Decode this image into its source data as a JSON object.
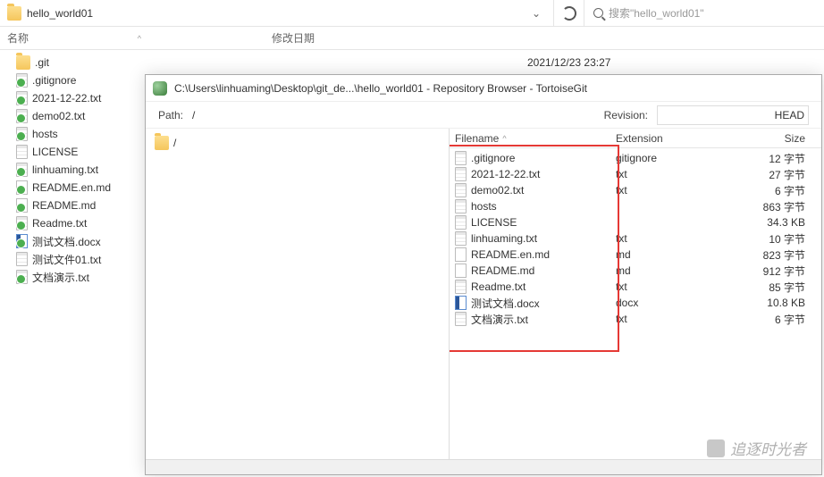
{
  "explorer": {
    "folder_title": "hello_world01",
    "search_placeholder": "搜索\"hello_world01\"",
    "columns": {
      "name": "名称",
      "date": "修改日期"
    },
    "first_date": "2021/12/23 23:27",
    "files": [
      {
        "name": ".git",
        "type": "folder",
        "overlay": false
      },
      {
        "name": ".gitignore",
        "type": "txt",
        "overlay": true
      },
      {
        "name": "2021-12-22.txt",
        "type": "txt",
        "overlay": true
      },
      {
        "name": "demo02.txt",
        "type": "txt",
        "overlay": true
      },
      {
        "name": "hosts",
        "type": "txt",
        "overlay": true
      },
      {
        "name": "LICENSE",
        "type": "txt",
        "overlay": false
      },
      {
        "name": "linhuaming.txt",
        "type": "txt",
        "overlay": true
      },
      {
        "name": "README.en.md",
        "type": "md",
        "overlay": true
      },
      {
        "name": "README.md",
        "type": "md",
        "overlay": true
      },
      {
        "name": "Readme.txt",
        "type": "txt",
        "overlay": true
      },
      {
        "name": "测试文档.docx",
        "type": "docx",
        "overlay": true
      },
      {
        "name": "测试文件01.txt",
        "type": "txt",
        "overlay": false
      },
      {
        "name": "文档演示.txt",
        "type": "txt",
        "overlay": true
      }
    ]
  },
  "git_window": {
    "title": "C:\\Users\\linhuaming\\Desktop\\git_de...\\hello_world01 - Repository Browser - TortoiseGit",
    "path_label": "Path:",
    "path_value": "/",
    "revision_label": "Revision:",
    "revision_value": "HEAD",
    "tree_root": "/",
    "columns": {
      "filename": "Filename",
      "extension": "Extension",
      "size": "Size"
    },
    "rows": [
      {
        "name": ".gitignore",
        "ext": "gitignore",
        "size": "12 字节"
      },
      {
        "name": "2021-12-22.txt",
        "ext": "txt",
        "size": "27 字节"
      },
      {
        "name": "demo02.txt",
        "ext": "txt",
        "size": "6 字节"
      },
      {
        "name": "hosts",
        "ext": "",
        "size": "863 字节"
      },
      {
        "name": "LICENSE",
        "ext": "",
        "size": "34.3 KB"
      },
      {
        "name": "linhuaming.txt",
        "ext": "txt",
        "size": "10 字节"
      },
      {
        "name": "README.en.md",
        "ext": "md",
        "size": "823 字节"
      },
      {
        "name": "README.md",
        "ext": "md",
        "size": "912 字节"
      },
      {
        "name": "Readme.txt",
        "ext": "txt",
        "size": "85 字节"
      },
      {
        "name": "测试文档.docx",
        "ext": "docx",
        "size": "10.8 KB"
      },
      {
        "name": "文档演示.txt",
        "ext": "txt",
        "size": "6 字节"
      }
    ]
  },
  "watermark": "追逐时光者"
}
